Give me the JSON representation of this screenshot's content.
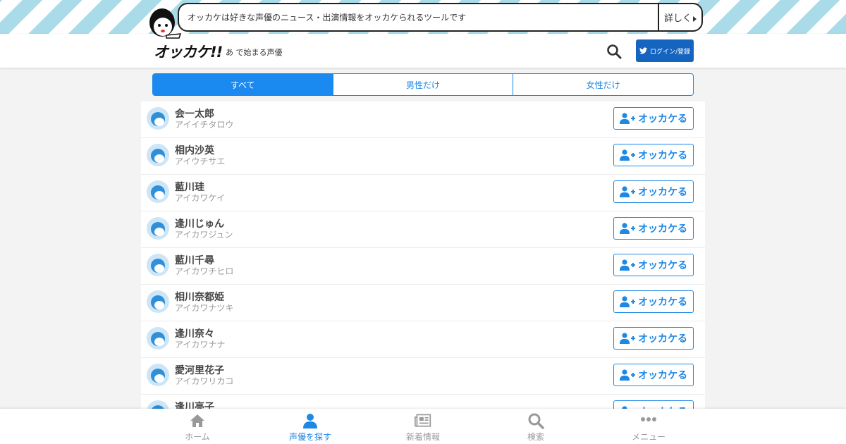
{
  "header": {
    "logo_text": "オッカケ!!",
    "subtitle": "あ で始まる声優",
    "banner_text": "オッカケは好きな声優のニュース・出演情報をオッカケられるツールです",
    "banner_more": "詳しく",
    "login_label": "ログイン/登録",
    "accent_color": "#1565c0"
  },
  "tabs": [
    {
      "label": "すべて",
      "active": true
    },
    {
      "label": "男性だけ",
      "active": false
    },
    {
      "label": "女性だけ",
      "active": false
    }
  ],
  "follow_label": "オッカケる",
  "actors": [
    {
      "name": "会一太郎",
      "kana": "アイイチタロウ"
    },
    {
      "name": "相内沙英",
      "kana": "アイウチサエ"
    },
    {
      "name": "藍川珪",
      "kana": "アイカワケイ"
    },
    {
      "name": "逢川じゅん",
      "kana": "アイカワジュン"
    },
    {
      "name": "藍川千尋",
      "kana": "アイカワチヒロ"
    },
    {
      "name": "相川奈都姫",
      "kana": "アイカワナツキ"
    },
    {
      "name": "逢川奈々",
      "kana": "アイカワナナ"
    },
    {
      "name": "愛河里花子",
      "kana": "アイカワリカコ"
    },
    {
      "name": "逢川亮子",
      "kana": ""
    }
  ],
  "bottom_nav": [
    {
      "label": "ホーム",
      "icon": "home-icon",
      "active": false
    },
    {
      "label": "声優を探す",
      "icon": "user-icon",
      "active": true
    },
    {
      "label": "新着情報",
      "icon": "newspaper-icon",
      "active": false
    },
    {
      "label": "検索",
      "icon": "search-icon",
      "active": false
    },
    {
      "label": "メニュー",
      "icon": "more-icon",
      "active": false
    }
  ]
}
